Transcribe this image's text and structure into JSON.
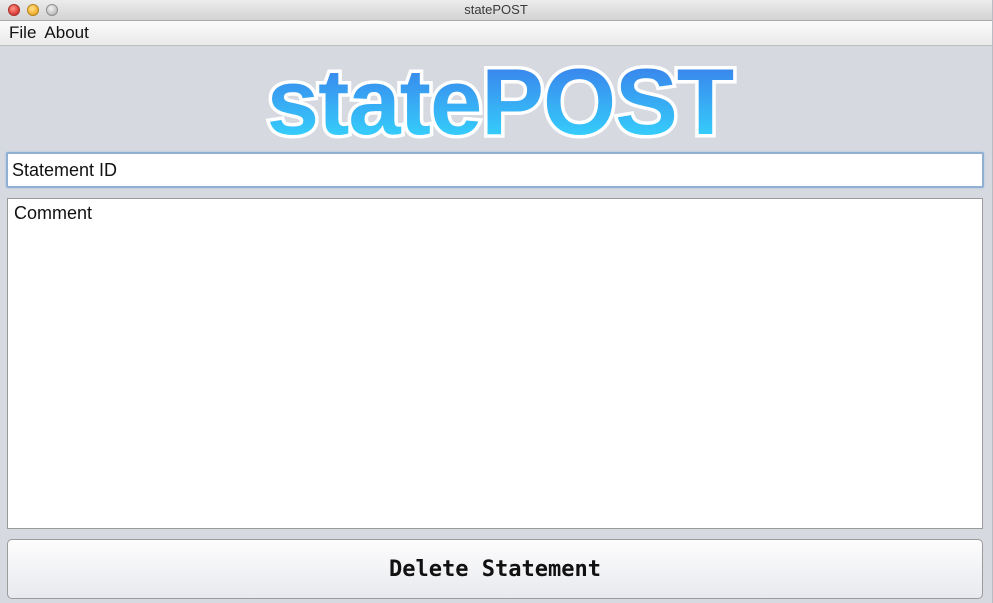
{
  "window": {
    "title": "statePOST"
  },
  "menu": {
    "items": [
      "File",
      "About"
    ]
  },
  "logo": {
    "text_part1": "state",
    "text_part2": "POST",
    "gradient_top": "#3a73e8",
    "gradient_bottom": "#35e0ff",
    "outline": "#ffffff"
  },
  "form": {
    "statement_id_value": "Statement ID",
    "comment_value": "Comment",
    "delete_button_label": "Delete Statement"
  },
  "colors": {
    "window_bg": "#d6d9e0",
    "field_focus_border": "#8fb0d2"
  }
}
